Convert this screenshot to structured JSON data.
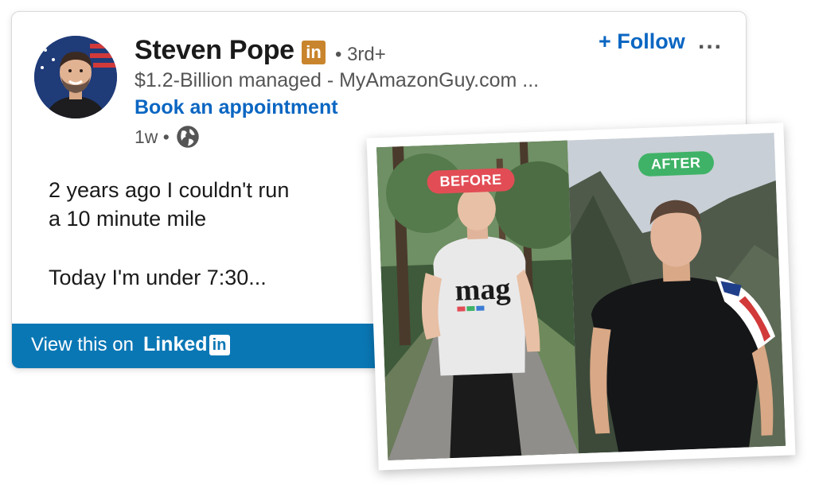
{
  "post": {
    "author_name": "Steven Pope",
    "badge_text": "in",
    "degree": "• 3rd+",
    "headline": "$1.2-Billion managed - MyAmazonGuy.com ...",
    "cta": "Book an appointment",
    "time": "1w •",
    "follow_label": "+ Follow",
    "more_label": "...",
    "text_line1": "2 years ago I couldn't run",
    "text_line2": "a 10 minute mile",
    "text_line3": "Today I'm under 7:30..."
  },
  "footer": {
    "view_label": "View this on",
    "brand_text": "Linked",
    "brand_box": "in"
  },
  "photo": {
    "before_label": "BEFORE",
    "after_label": "AFTER",
    "shirt_text": "mag"
  },
  "colors": {
    "link_blue": "#0a66c2",
    "bar_blue": "#0a77b5",
    "before_red": "#e24d55",
    "after_green": "#3fb267",
    "badge_gold": "#c9852d"
  },
  "icons": {
    "globe": "globe-icon",
    "more": "more-options-icon"
  }
}
